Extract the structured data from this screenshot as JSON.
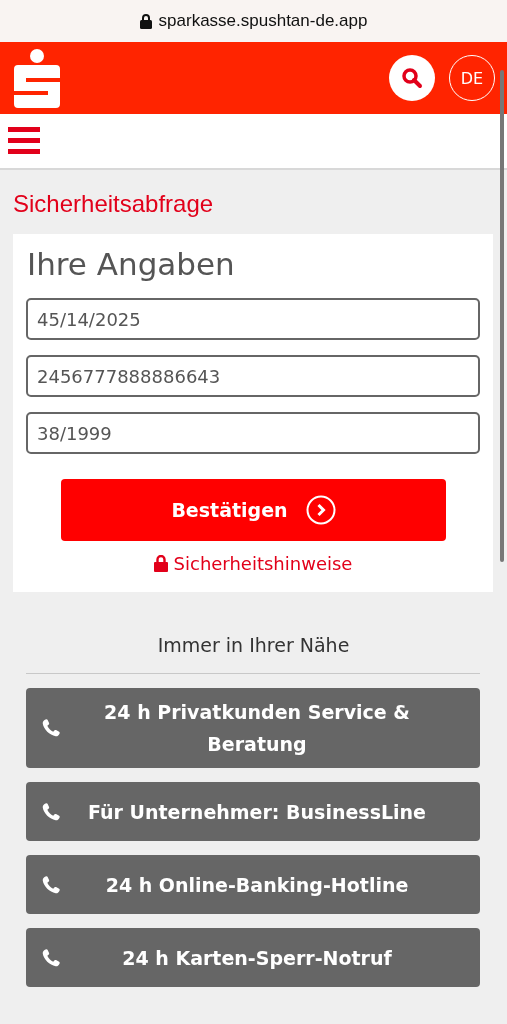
{
  "address_bar": {
    "url": "sparkasse.spushtan-de.app"
  },
  "header": {
    "language": "DE"
  },
  "page_title": "Sicherheitsabfrage",
  "form": {
    "title": "Ihre Angaben",
    "fields": [
      {
        "value": "45/14/2025"
      },
      {
        "value": "2456777888886643"
      },
      {
        "value": "38/1999"
      }
    ],
    "submit": "Bestätigen",
    "security_link": "Sicherheitshinweise"
  },
  "contact": {
    "heading": "Immer in Ihrer Nähe",
    "buttons": [
      "24 h Privatkunden Service & Beratung",
      "Für Unternehmer: BusinessLine",
      "24 h Online-Banking-Hotline",
      "24 h Karten-Sperr-Notruf"
    ]
  }
}
